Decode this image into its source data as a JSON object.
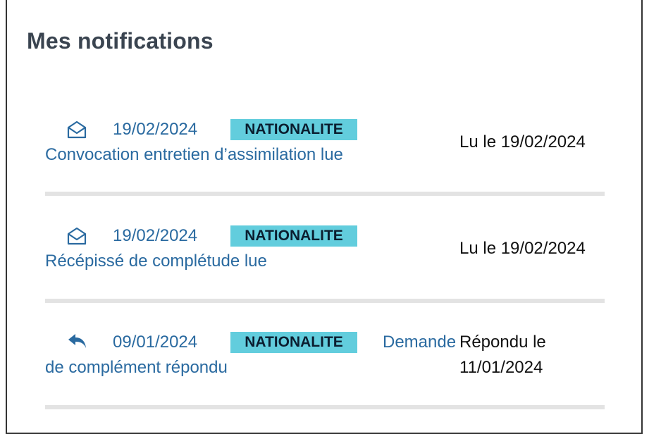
{
  "title": "Mes notifications",
  "notifications": [
    {
      "icon": "envelope-open-icon",
      "date": "19/02/2024",
      "badge": "NATIONALITE",
      "line1": "",
      "line2": "Convocation entretien d’assimilation lue",
      "status": "Lu le 19/02/2024"
    },
    {
      "icon": "envelope-open-icon",
      "date": "19/02/2024",
      "badge": "NATIONALITE",
      "line1": "",
      "line2": "Récépissé de complétude lue",
      "status": "Lu le 19/02/2024"
    },
    {
      "icon": "reply-icon",
      "date": "09/01/2024",
      "badge": "NATIONALITE",
      "line1": "Demande",
      "line2": "de complément répondu",
      "status_line1": "Répondu le",
      "status_line2": "11/01/2024"
    }
  ]
}
